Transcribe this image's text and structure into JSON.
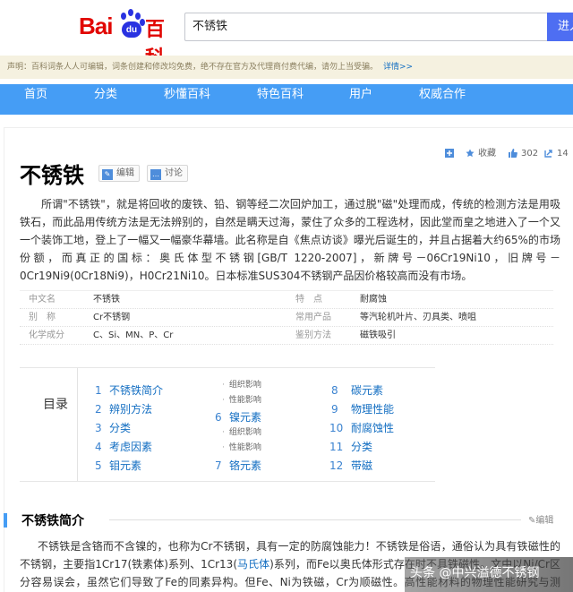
{
  "header": {
    "logo_bai": "Bai",
    "logo_du": "du",
    "logo_baike": "百科",
    "search_value": "不锈铁",
    "search_button": "进入"
  },
  "notice": {
    "text": "声明：百科词条人人可编辑，词条创建和修改均免费，绝不存在官方及代理商付费代编，请勿上当受骗。",
    "more": "详情>>"
  },
  "nav": {
    "items": [
      "首页",
      "分类",
      "秒懂百科",
      "特色百科",
      "用户",
      "权威合作"
    ]
  },
  "article": {
    "title": "不锈铁",
    "edit_label": "编辑",
    "discuss_label": "讨论",
    "collect_label": "收藏",
    "like_count": "302",
    "share_count": "14",
    "summary": "所谓\"不锈铁\"，就是将回收的废铁、铅、钢等经二次回炉加工，通过脱\"磁\"处理而成，传统的检测方法是用吸铁石，而此品用传统方法是无法辨别的，自然是瞒天过海，蒙住了众多的工程选材，因此堂而皇之地进入了一个又一个装饰工地，登上了一幅又一幅豪华幕墙。此名称是自《焦点访谈》曝光后诞生的，并且占据着大约65%的市场份额，而真正的国标：奥氏体型不锈钢[GB/T 1220-2007]，新牌号－06Cr19Ni10，旧牌号－0Cr19Ni9(0Cr18Ni9)，H0Cr21Ni10。日本标准SUS304不锈钢产品因价格较高而没有市场。"
  },
  "basic_info": [
    {
      "k1": "中文名",
      "v1": "不锈铁",
      "k2": "特　点",
      "v2": "耐腐蚀"
    },
    {
      "k1": "别　称",
      "v1": "Cr不锈钢",
      "k2": "常用产品",
      "v2": "等汽轮机叶片、刃具类、喷咀"
    },
    {
      "k1": "化学成分",
      "v1": "C、Si、MN、P、Cr",
      "k2": "鉴别方法",
      "v2": "磁铁吸引"
    }
  ],
  "toc": {
    "title": "目录",
    "items": [
      {
        "n": "1",
        "t": "不锈铁简介"
      },
      {
        "n": "2",
        "t": "辨别方法"
      },
      {
        "n": "3",
        "t": "分类"
      },
      {
        "n": "4",
        "t": "考虑因素"
      },
      {
        "n": "5",
        "t": "钼元素"
      },
      {
        "n": "6",
        "t": "镍元素"
      },
      {
        "n": "7",
        "t": "铬元素"
      },
      {
        "n": "8",
        "t": "碳元素"
      },
      {
        "n": "9",
        "t": "物理性能"
      },
      {
        "n": "10",
        "t": "耐腐蚀性"
      },
      {
        "n": "11",
        "t": "分类"
      },
      {
        "n": "12",
        "t": "带磁"
      }
    ],
    "subs": [
      "组织影响",
      "性能影响",
      "组织影响",
      "性能影响"
    ]
  },
  "section": {
    "title": "不锈铁简介",
    "edit": "编辑",
    "text_a": "不锈铁是含铬而不含镍的，也称为Cr不锈钢，具有一定的防腐蚀能力！不锈铁是俗语，通俗认为具有铁磁性的不锈钢，主要指1Cr17(铁素体)系列、1Cr13(",
    "text_link": "马氏体",
    "text_b": ")系列，而Fe以奥氏体形式存在时不具铁磁性。文中以Ni/Cr区分容易误会，虽然它们导致了Fe的同素异构。但Fe、Ni为铁磁，Cr为顺磁性。高性能材料的物理性能研究与测试。"
  },
  "watermark": "头条 @中兴溢德不锈钢"
}
